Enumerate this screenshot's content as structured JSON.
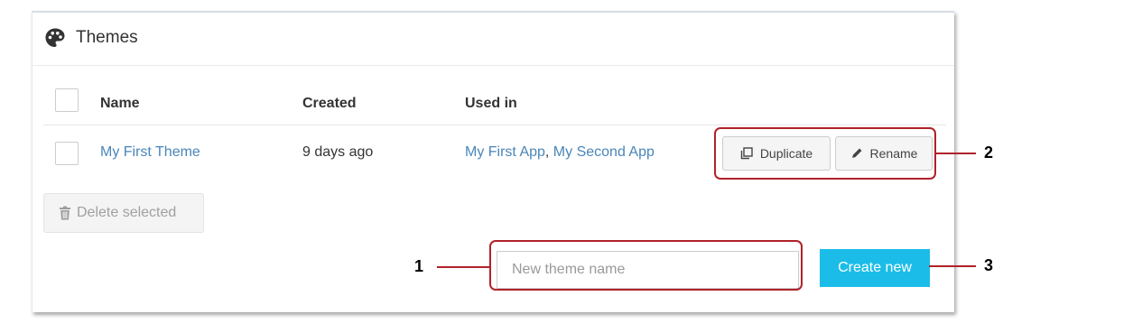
{
  "panel": {
    "title": "Themes",
    "title_icon": "palette-icon"
  },
  "table": {
    "columns": [
      "Name",
      "Created",
      "Used in"
    ],
    "rows": [
      {
        "name": "My First Theme",
        "created": "9 days ago",
        "used_in": [
          "My First App",
          "My Second App"
        ],
        "separator": ", ",
        "actions": {
          "duplicate": {
            "label": "Duplicate",
            "icon": "copy-icon"
          },
          "rename": {
            "label": "Rename",
            "icon": "pencil-icon"
          }
        }
      }
    ]
  },
  "delete_button": {
    "label": "Delete selected",
    "icon": "trash-icon",
    "disabled": true
  },
  "create": {
    "input_placeholder": "New theme name",
    "input_value": "",
    "button_label": "Create new"
  },
  "callouts": [
    {
      "number": "1",
      "target": "new-theme-name-input"
    },
    {
      "number": "2",
      "target": "row-action-buttons"
    },
    {
      "number": "3",
      "target": "create-new-button"
    }
  ],
  "colors": {
    "link": "#4a86b8",
    "primary_button": "#1bbde8",
    "callout": "#b0222a"
  }
}
